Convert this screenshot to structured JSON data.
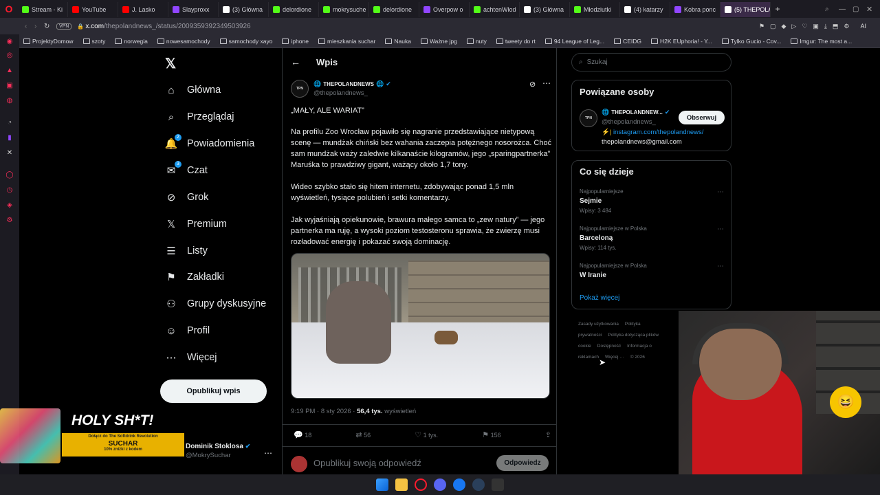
{
  "tabs": [
    {
      "label": "Stream - Ki",
      "color": "#53fc18"
    },
    {
      "label": "YouTube",
      "color": "#ff0000"
    },
    {
      "label": "J. Lasko",
      "color": "#ff0000"
    },
    {
      "label": "Slayproxx",
      "color": "#9146ff"
    },
    {
      "label": "(3) Główna",
      "color": "#ffffff"
    },
    {
      "label": "delordione",
      "color": "#53fc18"
    },
    {
      "label": "mokrysuche",
      "color": "#53fc18"
    },
    {
      "label": "delordione",
      "color": "#53fc18"
    },
    {
      "label": "Overpow o",
      "color": "#9146ff"
    },
    {
      "label": "achtenWlod",
      "color": "#53fc18"
    },
    {
      "label": "(3) Główna",
      "color": "#ffffff"
    },
    {
      "label": "Młodziutki",
      "color": "#53fc18"
    },
    {
      "label": "(4) katarzy",
      "color": "#ffffff"
    },
    {
      "label": "Kobra ponc",
      "color": "#9146ff"
    },
    {
      "label": "(5) THEPOLAND",
      "color": "#ffffff"
    }
  ],
  "address": {
    "vpn": "VPN",
    "url_host": "x.com",
    "url_path": "/thepolandnews_/status/2009359392349503926"
  },
  "bookmarks": [
    "ProjektyDomow",
    "szoty",
    "norwegia",
    "nowesamochody",
    "samochody xayo",
    "iphone",
    "mieszkania suchar",
    "Nauka",
    "Ważne jpg",
    "nuty",
    "tweety do rt",
    "94 League of Leg...",
    "CEIDG",
    "H2K EUphoria! - Y...",
    "Tylko Gucio - Cov...",
    "Imgur: The most a..."
  ],
  "nav": {
    "items": [
      {
        "label": "Główna",
        "icon": "home-icon",
        "glyph": "⌂"
      },
      {
        "label": "Przeglądaj",
        "icon": "search-icon",
        "glyph": "⌕"
      },
      {
        "label": "Powiadomienia",
        "icon": "bell-icon",
        "glyph": "🔔",
        "badge": "2"
      },
      {
        "label": "Czat",
        "icon": "mail-icon",
        "glyph": "✉",
        "badge": "3"
      },
      {
        "label": "Grok",
        "icon": "grok-icon",
        "glyph": "⊘"
      },
      {
        "label": "Premium",
        "icon": "x-icon",
        "glyph": "𝕏"
      },
      {
        "label": "Listy",
        "icon": "list-icon",
        "glyph": "☰"
      },
      {
        "label": "Zakładki",
        "icon": "bookmark-icon",
        "glyph": "⚑"
      },
      {
        "label": "Grupy dyskusyjne",
        "icon": "people-icon",
        "glyph": "⚇"
      },
      {
        "label": "Profil",
        "icon": "profile-icon",
        "glyph": "☺"
      },
      {
        "label": "Więcej",
        "icon": "more-icon",
        "glyph": "⋯"
      }
    ],
    "post_button": "Opublikuj wpis",
    "account_name": "Dominik Stoklosa",
    "account_handle": "@MokrySuchar"
  },
  "overlay_ad": {
    "headline": "HOLY SH*T!",
    "line1": "Dołącz do The Softdrink Revolution",
    "brand": "SUCHAR",
    "line2": "10% zniżki z kodem"
  },
  "post": {
    "header_title": "Wpis",
    "author_name": "THEPOLANDNEWS",
    "author_handle": "@thepolandnews_",
    "avatar_text": "TPN",
    "headline": "„MAŁY, ALE WARIAT”",
    "p1": "Na profilu Zoo Wrocław pojawiło się nagranie przedstawiające nietypową scenę — mundżak chiński bez wahania zaczepia potężnego nosorożca. Choć sam mundżak waży zaledwie kilkanaście kilogramów, jego „sparingpartnerka” Maruśka to prawdziwy gigant, ważący około 1,7 tony.",
    "p2": "Wideo szybko stało się hitem internetu, zdobywając ponad 1,5 mln wyświetleń, tysiące polubień i setki komentarzy.",
    "p3": "Jak wyjaśniają opiekunowie, brawura małego samca to „zew natury” — jego partnerka ma ruję, a wysoki poziom testosteronu sprawia, że zwierzę musi rozładować energię i pokazać swoją dominację.",
    "time": "9:19 PM · 8 sty 2026 ·",
    "views": "56,4 tys.",
    "views_label": "wyświetleń",
    "stats": {
      "replies": "18",
      "reposts": "56",
      "likes": "1 tys.",
      "bookmarks": "156"
    },
    "reply_placeholder": "Opublikuj swoją odpowiedź",
    "reply_button": "Odpowiedz"
  },
  "right": {
    "search_placeholder": "Szukaj",
    "related_title": "Powiązane osoby",
    "related": {
      "name": "THEPOLANDNEW...",
      "handle": "@thepolandnews_",
      "follow": "Obserwuj",
      "bio_link": "instagram.com/thepolandnews/",
      "bio_prefix": "⚡|",
      "email": "thepolandnews@gmail.com"
    },
    "trends_title": "Co się dzieje",
    "trends": [
      {
        "sub": "Najpopularniejsze",
        "title": "Sejmie",
        "count": "Wpisy: 3 484"
      },
      {
        "sub": "Najpopularniejsze w Polska",
        "title": "Barceloną",
        "count": "Wpisy: 114 tys."
      },
      {
        "sub": "Najpopularniejsze w Polska",
        "title": "W Iranie",
        "count": ""
      }
    ],
    "show_more": "Pokaż więcej",
    "footer": [
      "Zasady użytkowania",
      "Polityka prywatności",
      "Polityka dotycząca plików cookie",
      "Dostępność",
      "Informacja o reklamach",
      "Więcej ···",
      "© 2026"
    ]
  },
  "colors": {
    "accent": "#1d9bf0",
    "opera": "#ff1b2d"
  }
}
